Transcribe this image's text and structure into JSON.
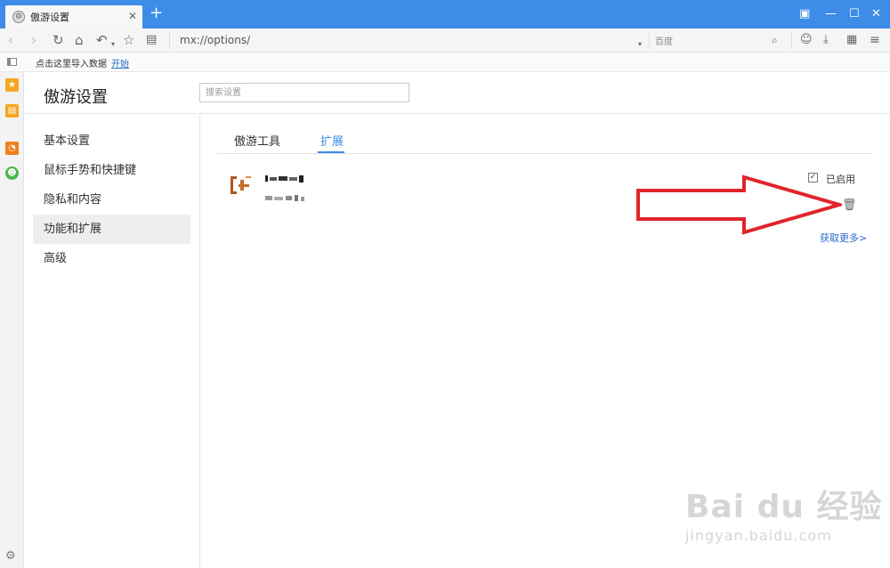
{
  "browser": {
    "tab_title": "傲游设置",
    "new_tab": "+",
    "url": "mx://options/",
    "search_engine": "百度"
  },
  "bookmarks": {
    "import_text": "点击这里导入数据",
    "start_link": "开始"
  },
  "settings": {
    "title": "傲游设置",
    "search_placeholder": "搜索设置",
    "nav": [
      {
        "label": "基本设置"
      },
      {
        "label": "鼠标手势和快捷键"
      },
      {
        "label": "隐私和内容"
      },
      {
        "label": "功能和扩展",
        "active": true
      },
      {
        "label": "高级"
      }
    ],
    "tabs": [
      {
        "label": "傲游工具"
      },
      {
        "label": "扩展",
        "active": true
      }
    ],
    "extension": {
      "enabled_label": "已启用",
      "enabled": true
    },
    "more_link": "获取更多>"
  },
  "watermark": {
    "main": "Bai du 经验",
    "sub": "jingyan.baidu.com"
  },
  "colors": {
    "accent": "#3d8ce8",
    "arrow": "#e0252b",
    "link": "#2a6cc9"
  },
  "icons": {
    "bookmark_star": "star-icon",
    "notes": "note-icon",
    "rss": "rss-icon",
    "chat": "smiley-icon",
    "settings": "gear-icon"
  }
}
